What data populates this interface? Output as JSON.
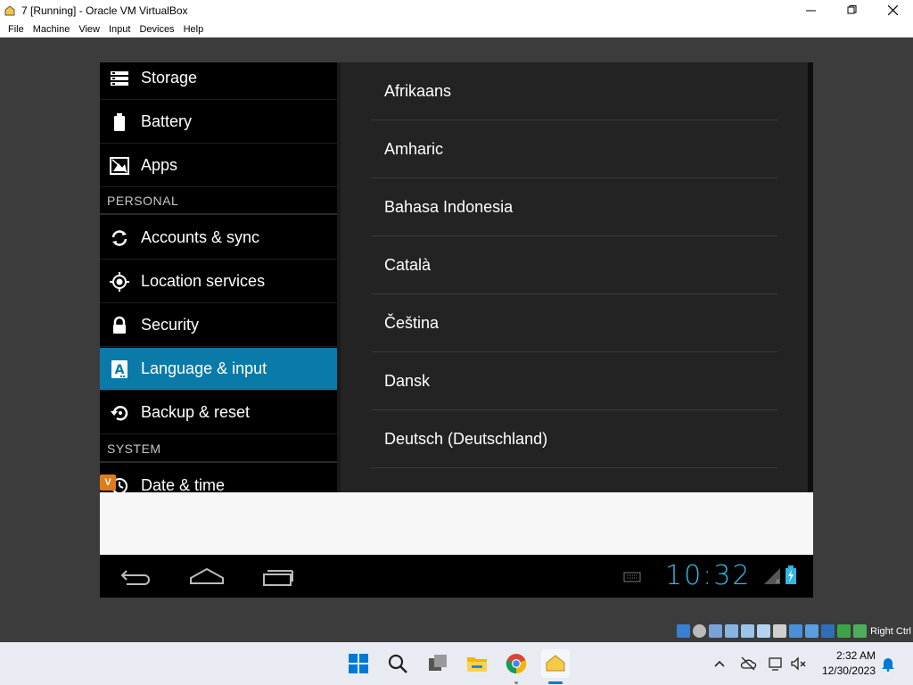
{
  "window": {
    "title": "7 [Running] - Oracle VM VirtualBox"
  },
  "menubar": [
    "File",
    "Machine",
    "View",
    "Input",
    "Devices",
    "Help"
  ],
  "android": {
    "settings_left": [
      {
        "type": "item",
        "label": "Storage",
        "icon": "storage-icon"
      },
      {
        "type": "item",
        "label": "Battery",
        "icon": "battery-icon"
      },
      {
        "type": "item",
        "label": "Apps",
        "icon": "apps-icon"
      },
      {
        "type": "header",
        "label": "PERSONAL"
      },
      {
        "type": "item",
        "label": "Accounts & sync",
        "icon": "sync-icon"
      },
      {
        "type": "item",
        "label": "Location services",
        "icon": "location-icon"
      },
      {
        "type": "item",
        "label": "Security",
        "icon": "lock-icon"
      },
      {
        "type": "item",
        "label": "Language & input",
        "icon": "language-icon",
        "selected": true
      },
      {
        "type": "item",
        "label": "Backup & reset",
        "icon": "backup-icon"
      },
      {
        "type": "header",
        "label": "SYSTEM"
      },
      {
        "type": "item",
        "label": "Date & time",
        "icon": "clock-icon"
      }
    ],
    "languages": [
      "Afrikaans",
      "Amharic",
      "Bahasa Indonesia",
      "Català",
      "Čeština",
      "Dansk",
      "Deutsch (Deutschland)"
    ],
    "clock": "10:32",
    "selected_color": "#0a7aa8",
    "clock_color": "#33b5e5"
  },
  "vbox_status": {
    "host_key": "Right Ctrl"
  },
  "taskbar": {
    "time": "2:32 AM",
    "date": "12/30/2023"
  }
}
